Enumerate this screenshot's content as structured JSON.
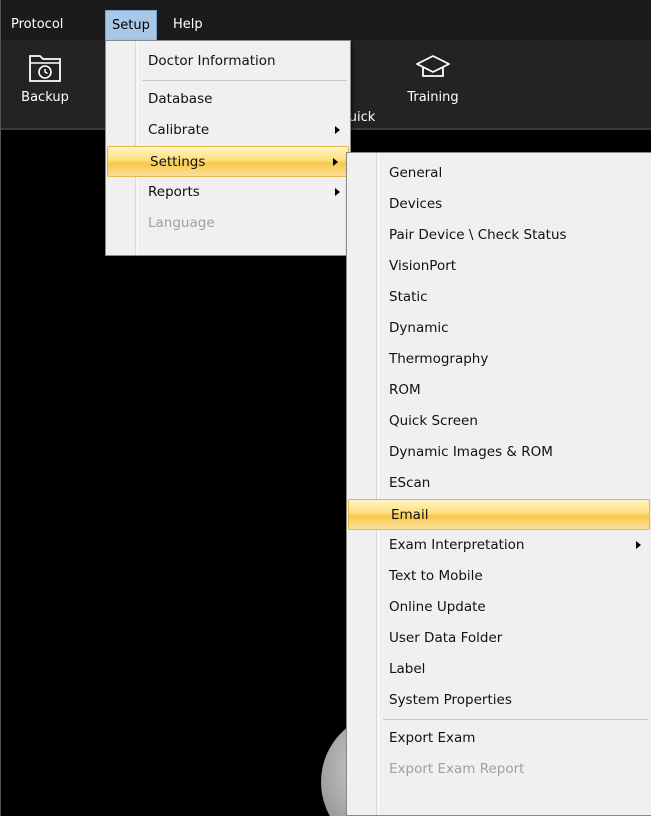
{
  "menubar": {
    "items": [
      {
        "label": "Protocol"
      },
      {
        "label": "Setup"
      },
      {
        "label": "Help"
      }
    ]
  },
  "toolbar": {
    "buttons": [
      {
        "label": "Backup",
        "icon": "backup-icon"
      },
      {
        "label": "uick",
        "icon": "quick-icon"
      },
      {
        "label": "Training",
        "icon": "training-icon"
      }
    ]
  },
  "setup_menu": {
    "items": [
      {
        "label": "Doctor Information"
      },
      {
        "label": "Database"
      },
      {
        "label": "Calibrate"
      },
      {
        "label": "Settings"
      },
      {
        "label": "Reports"
      },
      {
        "label": "Language"
      }
    ]
  },
  "settings_menu": {
    "items": [
      {
        "label": "General"
      },
      {
        "label": "Devices"
      },
      {
        "label": "Pair Device \\ Check  Status"
      },
      {
        "label": "VisionPort"
      },
      {
        "label": "Static"
      },
      {
        "label": "Dynamic"
      },
      {
        "label": "Thermography"
      },
      {
        "label": "ROM"
      },
      {
        "label": "Quick Screen"
      },
      {
        "label": "Dynamic Images & ROM"
      },
      {
        "label": "EScan"
      },
      {
        "label": "Email"
      },
      {
        "label": "Exam Interpretation"
      },
      {
        "label": "Text to Mobile"
      },
      {
        "label": "Online Update"
      },
      {
        "label": "User Data Folder"
      },
      {
        "label": "Label"
      },
      {
        "label": "System Properties"
      },
      {
        "label": "Export Exam"
      },
      {
        "label": "Export Exam Report"
      }
    ]
  },
  "colors": {
    "highlight": "#f8c84a",
    "menu_bg": "#f0f0f0",
    "open_menu_header": "#a8c8e8"
  }
}
